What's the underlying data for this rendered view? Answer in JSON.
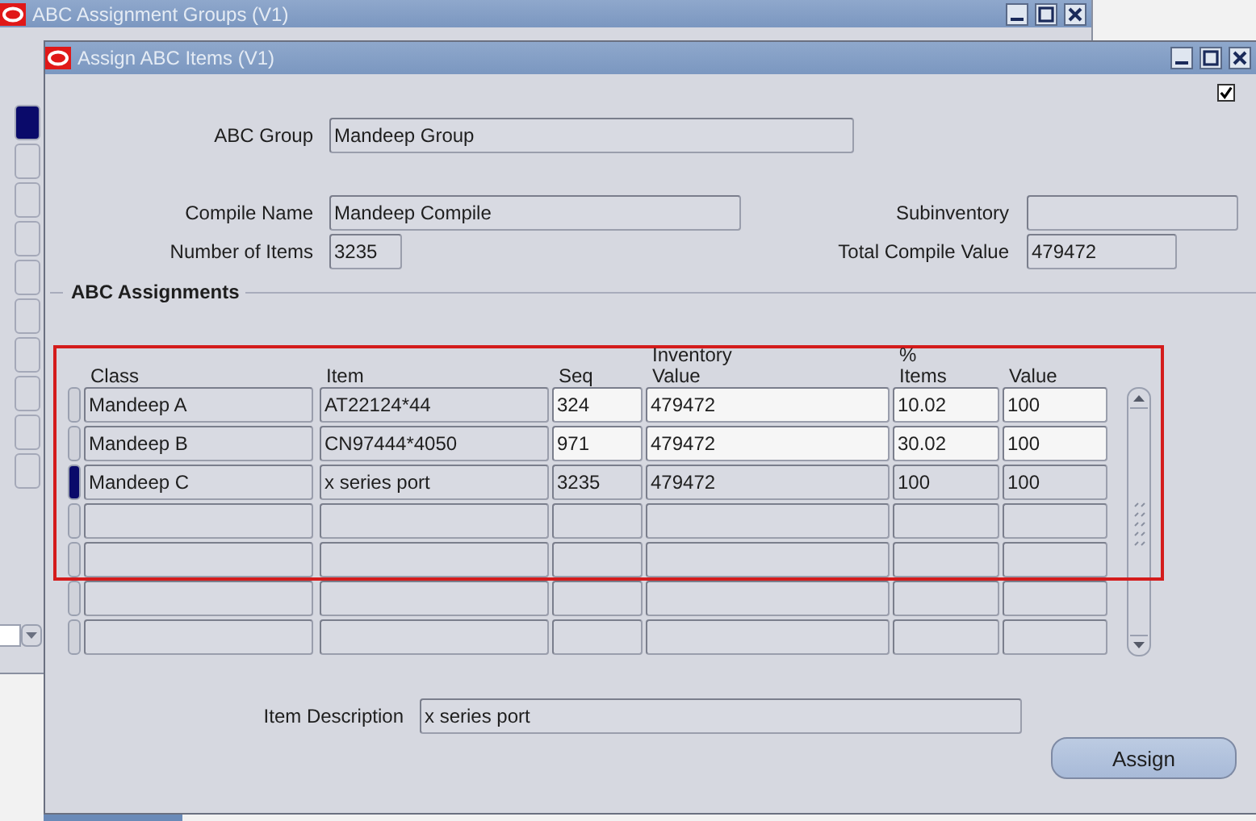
{
  "background_window": {
    "title": "ABC Assignment Groups (V1)"
  },
  "window": {
    "title": "Assign ABC Items (V1)",
    "checkbox_checked": true
  },
  "header": {
    "abc_group": {
      "label": "ABC Group",
      "value": "Mandeep Group"
    },
    "compile_name": {
      "label": "Compile Name",
      "value": "Mandeep Compile"
    },
    "subinventory": {
      "label": "Subinventory"
    },
    "number_of_items": {
      "label": "Number of Items",
      "value": "3235"
    },
    "total_compile_value": {
      "label": "Total Compile Value",
      "value": "479472"
    }
  },
  "assignments": {
    "title": "ABC Assignments",
    "columns": [
      {
        "label": "Class",
        "updatable": false
      },
      {
        "label": "Item",
        "updatable": false
      },
      {
        "label": "Seq",
        "updatable": true
      },
      {
        "label_top": "Inventory",
        "label": "Value",
        "updatable": true
      },
      {
        "label_top": "%",
        "label": "Items",
        "updatable": true
      },
      {
        "label": "Value",
        "updatable": true
      }
    ],
    "rows": [
      {
        "selected": false,
        "editable": true,
        "cells": [
          "Mandeep A",
          "AT22124*44",
          "324",
          "479472",
          "10.02",
          "100"
        ]
      },
      {
        "selected": false,
        "editable": true,
        "cells": [
          "Mandeep B",
          "CN97444*4050",
          "971",
          "479472",
          "30.02",
          "100"
        ]
      },
      {
        "selected": true,
        "editable": false,
        "cells": [
          "Mandeep C",
          "x series port",
          "3235",
          "479472",
          "100",
          "100"
        ]
      },
      {
        "selected": false,
        "editable": false
      },
      {
        "selected": false,
        "editable": false
      },
      {
        "selected": false,
        "editable": false
      },
      {
        "selected": false,
        "editable": false
      }
    ]
  },
  "item_description": {
    "label": "Item Description",
    "value": "x series port"
  },
  "buttons": [
    "Assign"
  ]
}
